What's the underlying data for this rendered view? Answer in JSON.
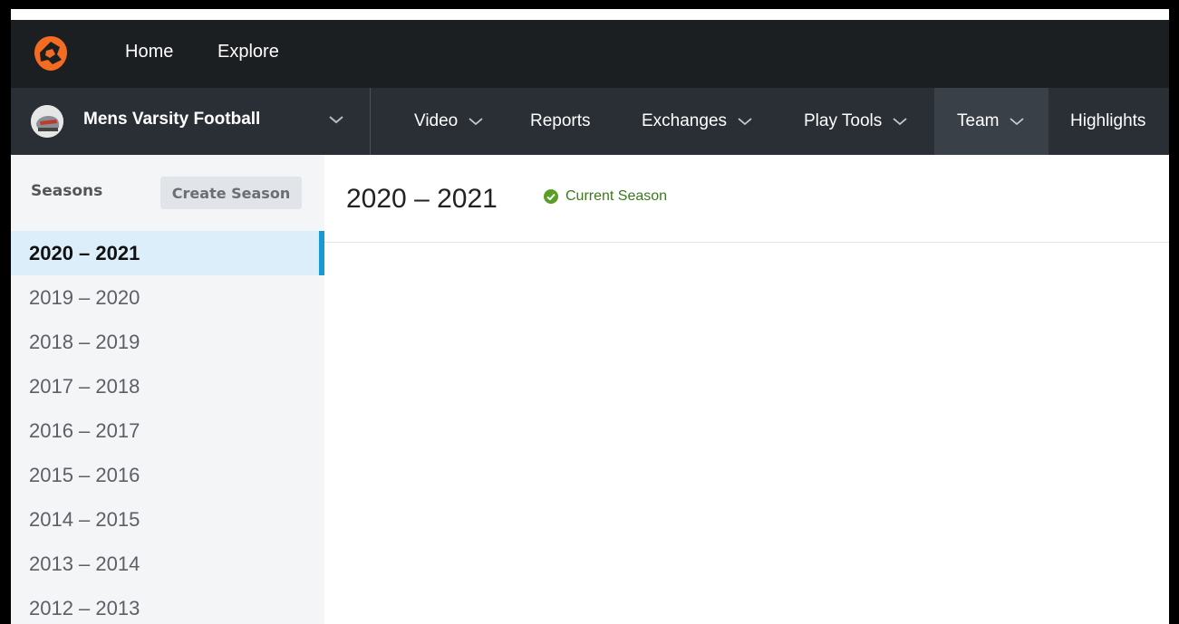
{
  "top_nav": {
    "links": [
      "Home",
      "Explore"
    ]
  },
  "team_bar": {
    "team_name": "Mens Varsity Football",
    "nav": [
      {
        "label": "Video",
        "has_dropdown": true
      },
      {
        "label": "Reports",
        "has_dropdown": false
      },
      {
        "label": "Exchanges",
        "has_dropdown": true
      },
      {
        "label": "Play Tools",
        "has_dropdown": true
      },
      {
        "label": "Team",
        "has_dropdown": true,
        "active": true
      },
      {
        "label": "Highlights",
        "has_dropdown": false
      }
    ]
  },
  "sidebar": {
    "header": "Seasons",
    "create_button": "Create Season",
    "seasons": [
      "2020 – 2021",
      "2019 – 2020",
      "2018 – 2019",
      "2017 – 2018",
      "2016 – 2017",
      "2015 – 2016",
      "2014 – 2015",
      "2013 – 2014",
      "2012 – 2013"
    ],
    "selected_index": 0
  },
  "main": {
    "title": "2020 – 2021",
    "badge": "Current Season"
  },
  "colors": {
    "topbar": "#1c1f22",
    "teambar": "#2a2f35",
    "accent": "#1799d6",
    "success": "#5a9e25"
  },
  "icons": {
    "logo": "hudl-logo-icon",
    "chevron": "chevron-down-icon",
    "check": "check-circle-icon"
  }
}
